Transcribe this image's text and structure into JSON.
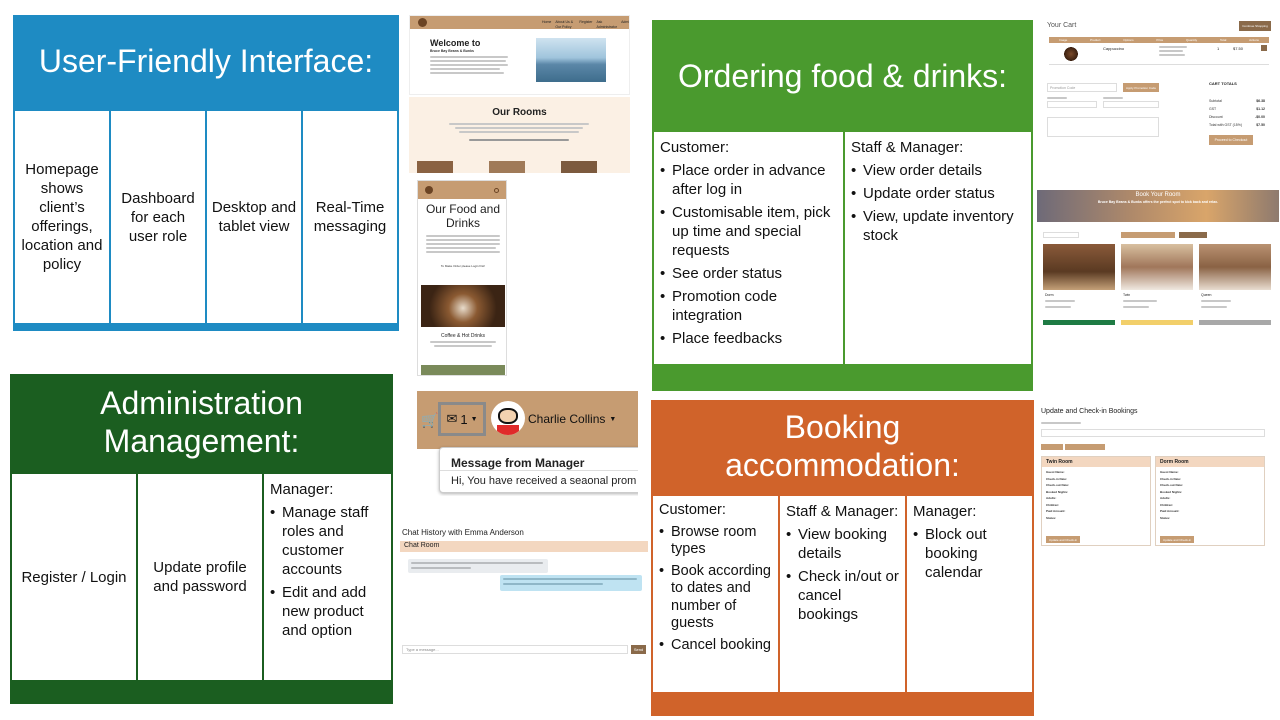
{
  "colors": {
    "ui_blue": "#1e8bc3",
    "ordering_green": "#4a9a2e",
    "admin_green": "#1b5e20",
    "booking_orange": "#d0632a",
    "tan": "#c69c72"
  },
  "ui_panel": {
    "title": "User-Friendly Interface:",
    "cells": [
      "Homepage shows client’s offerings, location and policy",
      "Dashboard for each user role",
      "Desktop and tablet view",
      "Real-Time messaging"
    ]
  },
  "ordering_panel": {
    "title": "Ordering food & drinks:",
    "customer": {
      "heading": "Customer:",
      "items": [
        "Place order in advance after log in",
        "Customisable item, pick up time and special requests",
        "See order status",
        "Promotion code integration",
        "Place feedbacks"
      ]
    },
    "staff": {
      "heading": "Staff & Manager:",
      "items": [
        "View order details",
        "Update order status",
        "View, update inventory stock"
      ]
    }
  },
  "admin_panel": {
    "title_line1": "Administration",
    "title_line2": "Management:",
    "cells": [
      "Register / Login",
      "Update profile and password"
    ],
    "manager": {
      "heading": "Manager:",
      "items": [
        "Manage staff roles and customer accounts",
        "Edit and add new product and option"
      ]
    }
  },
  "booking_panel": {
    "title_line1": "Booking",
    "title_line2": "accommodation:",
    "customer": {
      "heading": "Customer:",
      "items": [
        "Browse room types",
        "Book according to dates and number of guests",
        "Cancel booking"
      ]
    },
    "staff": {
      "heading": "Staff & Manager:",
      "items": [
        "View booking details",
        "Check in/out or cancel bookings"
      ]
    },
    "manager": {
      "heading": "Manager:",
      "items": [
        "Block out booking calendar"
      ]
    }
  },
  "shots": {
    "welcome": {
      "heading": "Welcome to",
      "subheading": "Bruce Bay Beans & Bunks",
      "nav": [
        "Home",
        "About Us & Our Policy",
        "Register",
        "Ask Administrator",
        "Admin"
      ]
    },
    "rooms": {
      "heading": "Our Rooms"
    },
    "food": {
      "heading": "Our Food and Drinks",
      "card_label": "Coffee & Hot Drinks",
      "order_note": "To Make Order please Login first!"
    },
    "message": {
      "count": "1",
      "user": "Charlie Collins",
      "popup_title": "Message from Manager",
      "popup_body": "Hi, You have received a seaonal prom"
    },
    "chat": {
      "title": "Chat History with Emma Anderson",
      "room": "Chat Room",
      "placeholder": "Type a message...",
      "send": "Send"
    },
    "cart": {
      "title": "Your Cart",
      "continue": "Continue Shopping",
      "headers": [
        "Image",
        "Product",
        "Options",
        "Price",
        "Quantity",
        "Total",
        "Actions"
      ],
      "item": "Cappuccino",
      "qty": "1",
      "total": "$7.50",
      "promo_placeholder": "Promotion Code",
      "promo_button": "Apply Promotion Code",
      "totals_title": "CART TOTALS",
      "totals_labels": [
        "Subtotal",
        "GST",
        "Discount",
        "Total with GST (15%)"
      ],
      "totals_values": [
        "$6.38",
        "$1.12",
        "-$0.00",
        "$7.50"
      ],
      "checkout": "Proceed to Checkout"
    },
    "book_room": {
      "title": "Book Your Room",
      "subtitle": "Bruce Bay Beans & Bunks offers the perfect spot to kick back and relax.",
      "rooms": [
        "Dorm",
        "Twin",
        "Queen"
      ]
    },
    "checkin": {
      "title": "Update and Check-in Bookings",
      "rooms": [
        "Twin Room",
        "Dorm Room"
      ],
      "field_labels": [
        "Guest Name:",
        "Check-in Date:",
        "Check-out Date:",
        "Booked Nights:",
        "Adults:",
        "Children:",
        "Paid Amount:",
        "Status:"
      ],
      "button": "Update and Check-in"
    }
  }
}
